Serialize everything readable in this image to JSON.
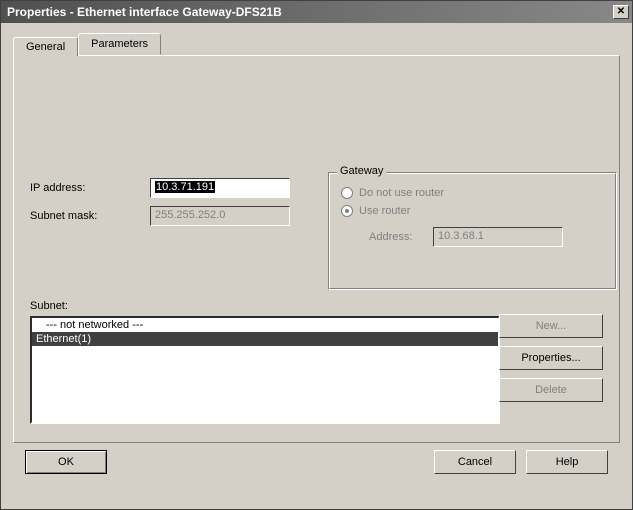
{
  "window": {
    "title": "Properties - Ethernet interface  Gateway-DFS21B"
  },
  "tabs": {
    "general": "General",
    "parameters": "Parameters",
    "active_index": 1
  },
  "fields": {
    "ip_label": "IP address:",
    "ip_value": "10.3.71.191",
    "subnet_label": "Subnet mask:",
    "subnet_value": "255.255.252.0"
  },
  "gateway": {
    "legend": "Gateway",
    "no_router_label": "Do not use router",
    "use_router_label": "Use router",
    "selected": "use_router",
    "address_label": "Address:",
    "address_value": "10.3.68.1"
  },
  "subnet": {
    "label": "Subnet:",
    "items": [
      {
        "text": "--- not networked ---",
        "selected": false
      },
      {
        "text": "Ethernet(1)",
        "selected": true
      }
    ]
  },
  "buttons": {
    "new": "New...",
    "properties": "Properties...",
    "delete": "Delete",
    "ok": "OK",
    "cancel": "Cancel",
    "help": "Help"
  },
  "colors": {
    "face": "#d4d0c8",
    "text_disabled": "#808080",
    "selection_bg": "#404040"
  }
}
